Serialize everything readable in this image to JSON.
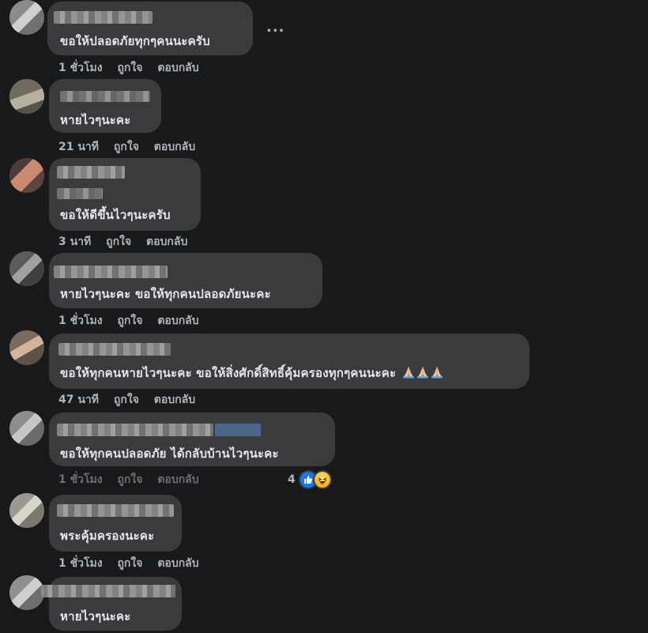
{
  "more_label": "...",
  "comments": [
    {
      "text": "ขอให้ปลอดภัยทุกๆคนนะครับ",
      "time": "1 ชั่วโมง",
      "like": "ถูกใจ",
      "reply": "ตอบกลับ"
    },
    {
      "text": "หายไวๆนะคะ",
      "time": "21 นาที",
      "like": "ถูกใจ",
      "reply": "ตอบกลับ"
    },
    {
      "text": "ขอให้ดีขึ้นไวๆนะครับ",
      "time": "3 นาที",
      "like": "ถูกใจ",
      "reply": "ตอบกลับ"
    },
    {
      "text": "หายไวๆนะคะ ขอให้ทุกคนปลอดภัยนะคะ",
      "time": "1 ชั่วโมง",
      "like": "ถูกใจ",
      "reply": "ตอบกลับ"
    },
    {
      "text": "ขอให้ทุกคนหายไวๆนะคะ ขอให้สิ่งศักดิ์สิทธิ์คุ้มครองทุกๆคนนะคะ",
      "time": "47 นาที",
      "like": "ถูกใจ",
      "reply": "ตอบกลับ",
      "emoji_icons": [
        "folded-hands",
        "folded-hands",
        "folded-hands"
      ]
    },
    {
      "text": "ขอให้ทุกคนปลอดภัย ได้กลับบ้านไวๆนะคะ",
      "time": "1 ชั่วโมง",
      "like": "ถูกใจ",
      "reply": "ตอบกลับ",
      "reaction_count": "4",
      "reaction_icons": [
        "like",
        "haha"
      ]
    },
    {
      "text": "พระคุ้มครองนะคะ",
      "time": "1 ชั่วโมง",
      "like": "ถูกใจ",
      "reply": "ตอบกลับ"
    },
    {
      "text": "หายไวๆนะคะ"
    }
  ],
  "colors": {
    "background": "#18191a",
    "bubble": "#3a3b3c",
    "text": "#e4e6eb",
    "meta": "#b0b3b8",
    "like_blue": "#1877f2"
  }
}
